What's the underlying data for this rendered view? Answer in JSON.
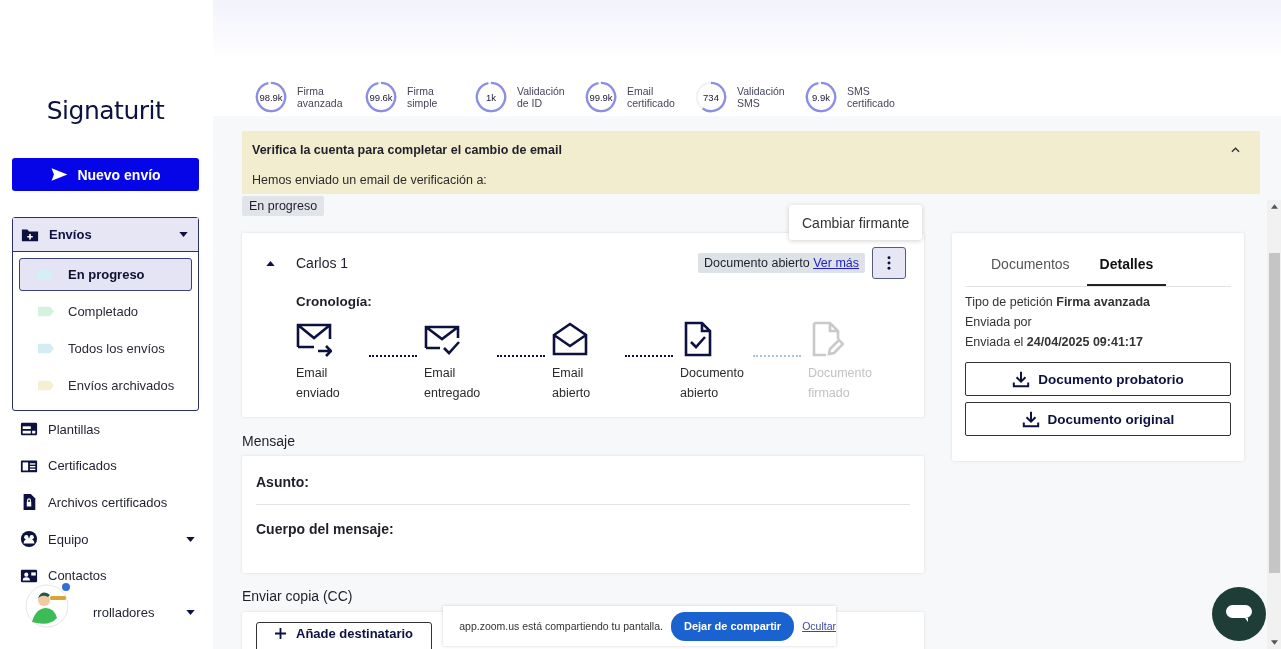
{
  "sidebar": {
    "logo": "Signaturit",
    "new_button": "Nuevo envío",
    "nav": [
      {
        "label": "Envíos",
        "kind": "folder",
        "dropdown": true,
        "expanded": true,
        "children": [
          {
            "label": "En progreso",
            "color": "#d4eff6",
            "selected": true
          },
          {
            "label": "Completado",
            "color": "#d5f2de",
            "selected": false
          },
          {
            "label": "Todos los envíos",
            "color": "#d4edf3",
            "selected": false
          },
          {
            "label": "Envíos archivados",
            "color": "#f5efd3",
            "selected": false
          }
        ]
      },
      {
        "label": "Plantillas",
        "kind": "template",
        "dropdown": false
      },
      {
        "label": "Certificados",
        "kind": "certificate",
        "dropdown": false
      },
      {
        "label": "Archivos certificados",
        "kind": "lockfile",
        "dropdown": false
      },
      {
        "label": "Equipo",
        "kind": "team",
        "dropdown": true
      },
      {
        "label": "Contactos",
        "kind": "contacts",
        "dropdown": false
      },
      {
        "label": "rrolladores",
        "kind": "covered",
        "dropdown": true
      }
    ]
  },
  "stats": [
    {
      "value": "98.9k",
      "label_lines": [
        "Firma",
        "avanzada"
      ],
      "level": 0.97
    },
    {
      "value": "99.6k",
      "label_lines": [
        "Firma",
        "simple"
      ],
      "level": 0.97
    },
    {
      "value": "1k",
      "label_lines": [
        "Validación",
        "de ID"
      ],
      "level": 0.97
    },
    {
      "value": "99.9k",
      "label_lines": [
        "Email",
        "certificado"
      ],
      "level": 0.97
    },
    {
      "value": "734",
      "label_lines": [
        "Validación",
        "SMS"
      ],
      "level": 0.6
    },
    {
      "value": "9.9k",
      "label_lines": [
        "SMS",
        "certificado"
      ],
      "level": 0.97
    }
  ],
  "banner": {
    "title": "Verifica la cuenta para completar el cambio de email",
    "message": "Hemos enviado un email de verificación a:",
    "expanded": true
  },
  "status_tag": "En progreso",
  "menu": {
    "items": [
      "Cambiar firmante"
    ]
  },
  "signer": {
    "name": "Carlos 1",
    "expanded": true,
    "status": "Documento abierto",
    "link": "Ver más",
    "timeline_title": "Cronología:",
    "steps": [
      {
        "kind": "sent",
        "lines": [
          "Email",
          "enviado"
        ],
        "done": true
      },
      {
        "kind": "delivered",
        "lines": [
          "Email",
          "entregado"
        ],
        "done": true
      },
      {
        "kind": "opened",
        "lines": [
          "Email",
          "abierto"
        ],
        "done": true
      },
      {
        "kind": "document",
        "lines": [
          "Documento",
          "abierto"
        ],
        "done": true
      },
      {
        "kind": "signed",
        "lines": [
          "Documento",
          "firmado"
        ],
        "done": false
      }
    ]
  },
  "details": {
    "tabs": [
      {
        "label": "Documentos",
        "selected": false
      },
      {
        "label": "Detalles",
        "selected": true
      }
    ],
    "lines": [
      "Tipo de petición **Firma avanzada**",
      "Enviada por",
      "Enviada el **24/04/2025 09:41:17**"
    ],
    "buttons": [
      "Documento probatorio",
      "Documento original"
    ]
  },
  "message": {
    "title": "Mensaje",
    "fields": [
      "Asunto:",
      "Cuerpo del mensaje:"
    ]
  },
  "cc": {
    "title": "Enviar copia (CC)",
    "button": "Añade destinatario"
  },
  "share_bar": {
    "message": "app.zoom.us está compartiendo tu pantalla.",
    "stop": "Dejar de compartir",
    "hide": "Ocultar"
  }
}
